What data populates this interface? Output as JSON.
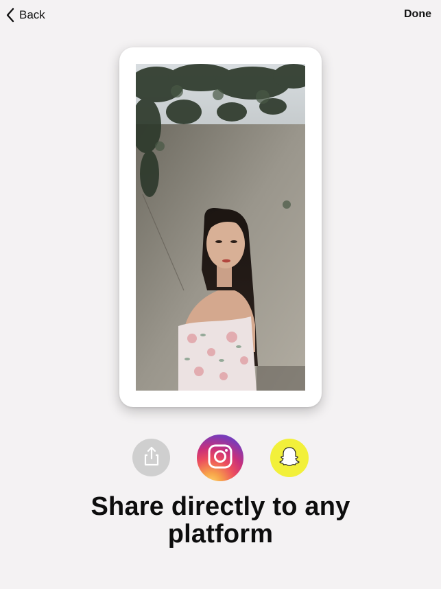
{
  "nav": {
    "back_label": "Back",
    "back_icon": "chevron-left-icon",
    "done_label": "Done"
  },
  "preview": {
    "image_description_icon": "photo-preview"
  },
  "share": {
    "buttons": [
      {
        "id": "generic",
        "icon": "share-icon",
        "color": "#cfcfcf"
      },
      {
        "id": "instagram",
        "icon": "instagram-icon",
        "color": "#c9307a"
      },
      {
        "id": "snapchat",
        "icon": "snapchat-ghost-icon",
        "color": "#f2f03a"
      }
    ]
  },
  "headline": {
    "line1": "Share directly to any",
    "line2": "platform"
  },
  "colors": {
    "background": "#f4f2f3",
    "card": "#ffffff",
    "text": "#0d0d0d"
  }
}
